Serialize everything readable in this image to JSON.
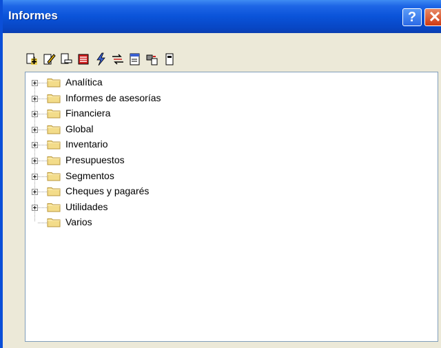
{
  "window": {
    "title": "Informes"
  },
  "titlebar_buttons": {
    "help": "?",
    "close": "✕"
  },
  "toolbar": {
    "icons": [
      "add-report-icon",
      "edit-report-icon",
      "remove-report-icon",
      "properties-icon",
      "run-icon",
      "transfer-icon",
      "preview-icon",
      "print-icon",
      "settings-icon"
    ]
  },
  "tree": {
    "items": [
      {
        "label": "Analítica",
        "expandable": true
      },
      {
        "label": "Informes de asesorías",
        "expandable": true
      },
      {
        "label": "Financiera",
        "expandable": true
      },
      {
        "label": "Global",
        "expandable": true
      },
      {
        "label": "Inventario",
        "expandable": true
      },
      {
        "label": "Presupuestos",
        "expandable": true
      },
      {
        "label": "Segmentos",
        "expandable": true
      },
      {
        "label": "Cheques y pagarés",
        "expandable": true
      },
      {
        "label": "Utilidades",
        "expandable": true
      },
      {
        "label": "Varios",
        "expandable": false
      }
    ]
  },
  "colors": {
    "titlebar": "#0a53d9",
    "folder": "#f3dc8a",
    "panel": "#ece9d8"
  }
}
